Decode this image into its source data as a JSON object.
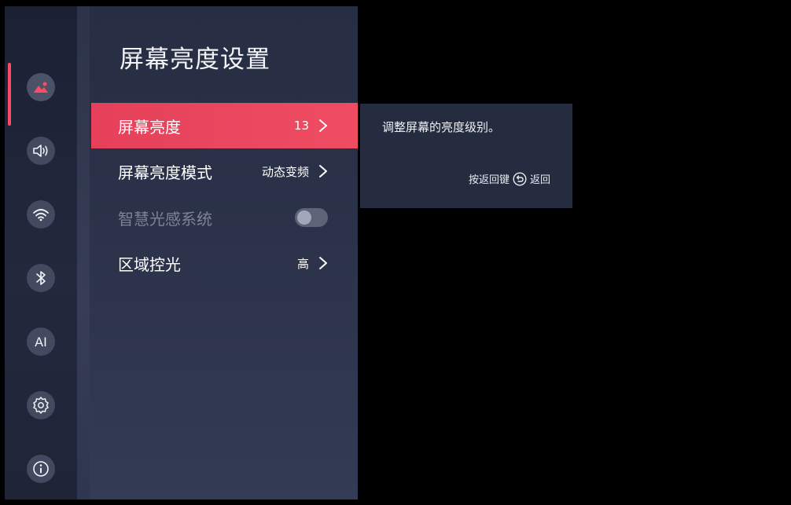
{
  "rail": {
    "items": [
      {
        "icon": "picture-icon"
      },
      {
        "icon": "speaker-icon"
      },
      {
        "icon": "wifi-icon"
      },
      {
        "icon": "bluetooth-icon"
      },
      {
        "icon": "ai-icon",
        "label": "AI"
      },
      {
        "icon": "gear-icon"
      },
      {
        "icon": "info-icon"
      }
    ],
    "accent": "#ff4a63"
  },
  "panel": {
    "title": "屏幕亮度设置",
    "items": [
      {
        "label": "屏幕亮度",
        "value": "13",
        "selected": true
      },
      {
        "label": "屏幕亮度模式",
        "value": "动态变频"
      },
      {
        "label": "智慧光感系统",
        "toggle": false,
        "disabled": true
      },
      {
        "label": "区域控光",
        "value": "高"
      }
    ]
  },
  "hint": {
    "description": "调整屏幕的亮度级别。",
    "footer_prefix": "按返回键",
    "footer_suffix": "返回",
    "icon": "back-icon"
  },
  "colors": {
    "selected_row": "#e6405b",
    "panel_bg": "#2b3249",
    "rail_bg": "#1b2133"
  }
}
